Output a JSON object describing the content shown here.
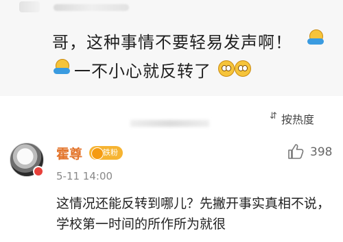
{
  "quoted_comment": {
    "line1": "哥，这种事情不要轻易发声啊！",
    "line2": "一不小心就反转了"
  },
  "sort": {
    "label": "按热度",
    "icon": "sort-icon"
  },
  "comment": {
    "username": "霍尊",
    "badge": "铁粉",
    "likes": "398",
    "timestamp": "5-11 14:00",
    "text": "这情况还能反转到哪儿？先撇开事实真相不说，学校第一时间的所作所为就很"
  },
  "colors": {
    "username": "#e3742b",
    "badge": "#f6b432"
  }
}
